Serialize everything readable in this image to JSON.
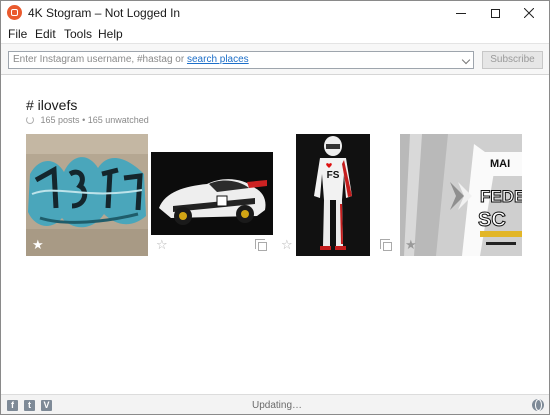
{
  "window": {
    "title": "4K Stogram – Not Logged In"
  },
  "menu": {
    "items": [
      "File",
      "Edit",
      "Tools",
      "Help"
    ]
  },
  "search": {
    "placeholder_prefix": "Enter Instagram username, #hastag or",
    "placeholder_link": "search places",
    "subscribe_label": "Subscribe"
  },
  "feed": {
    "hashtag": "# ilovefs",
    "posts": "165 posts",
    "separator": "•",
    "unwatched": "165 unwatched",
    "images": [
      {
        "name": "graffiti-wall",
        "star": "★",
        "multi": false
      },
      {
        "name": "race-car",
        "star": "☆",
        "multi": true
      },
      {
        "name": "racing-driver",
        "star": "☆",
        "multi": true
      },
      {
        "name": "federal-screen-poster",
        "star": "★",
        "multi": false
      }
    ]
  },
  "status": {
    "text": "Updating…"
  },
  "social": {
    "facebook": "f",
    "twitter": "t",
    "vimeo": "V"
  },
  "colors": {
    "accent": "#ea5a2e",
    "link": "#1d6fc9"
  }
}
